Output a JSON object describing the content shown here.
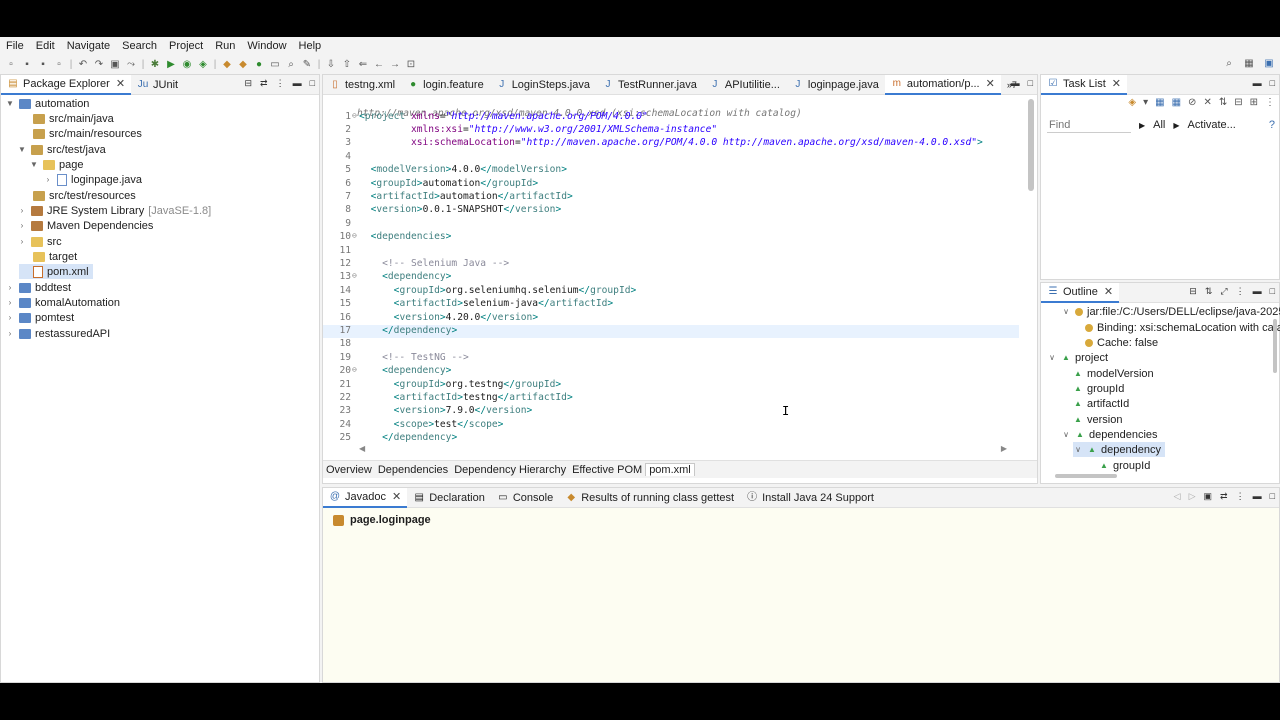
{
  "menu": [
    "File",
    "Edit",
    "Navigate",
    "Search",
    "Project",
    "Run",
    "Window",
    "Help"
  ],
  "explorer": {
    "tabs": [
      {
        "label": "Package Explorer"
      },
      {
        "label": "JUnit"
      }
    ],
    "items": [
      {
        "label": "automation"
      },
      {
        "label": "src/main/java"
      },
      {
        "label": "src/main/resources"
      },
      {
        "label": "src/test/java"
      },
      {
        "label": "page"
      },
      {
        "label": "loginpage.java"
      },
      {
        "label": "src/test/resources"
      },
      {
        "label": "JRE System Library",
        "extra": "[JavaSE-1.8]"
      },
      {
        "label": "Maven Dependencies"
      },
      {
        "label": "src"
      },
      {
        "label": "target"
      },
      {
        "label": "pom.xml"
      },
      {
        "label": "bddtest"
      },
      {
        "label": "komalAutomation"
      },
      {
        "label": "pomtest"
      },
      {
        "label": "restassuredAPI"
      }
    ]
  },
  "editor": {
    "tabs": [
      "testng.xml",
      "login.feature",
      "LoginSteps.java",
      "TestRunner.java",
      "APIutilitie...",
      "loginpage.java",
      "automation/p..."
    ],
    "overflow": "»7",
    "header_line": "http://maven.apache.org/xsd/maven-4.0.0.xsd (xsi:schemaLocation with catalog)",
    "lines": [
      {
        "n": "1",
        "fold": "⊖",
        "html": "<span class='br'>&lt;</span><span class='tagc'>project</span> <span class='attr'>xmlns</span>=<span class='str'>\"http://maven.apache.org/POM/4.0.0\"</span>"
      },
      {
        "n": "2",
        "html": "         <span class='attr'>xmlns:xsi</span>=<span class='str'>\"http://www.w3.org/2001/XMLSchema-instance\"</span>"
      },
      {
        "n": "3",
        "html": "         <span class='attr'>xsi:schemaLocation</span>=<span class='str'>\"http://maven.apache.org/POM/4.0.0 http://maven.apache.org/xsd/maven-4.0.0.xsd\"</span><span class='br'>&gt;</span>"
      },
      {
        "n": "4",
        "html": ""
      },
      {
        "n": "5",
        "html": "  <span class='br'>&lt;</span><span class='tagc'>modelVersion</span><span class='br'>&gt;</span>4.0.0<span class='br'>&lt;/</span><span class='tagc'>modelVersion</span><span class='br'>&gt;</span>"
      },
      {
        "n": "6",
        "html": "  <span class='br'>&lt;</span><span class='tagc'>groupId</span><span class='br'>&gt;</span>automation<span class='br'>&lt;/</span><span class='tagc'>groupId</span><span class='br'>&gt;</span>"
      },
      {
        "n": "7",
        "html": "  <span class='br'>&lt;</span><span class='tagc'>artifactId</span><span class='br'>&gt;</span>automation<span class='br'>&lt;/</span><span class='tagc'>artifactId</span><span class='br'>&gt;</span>"
      },
      {
        "n": "8",
        "html": "  <span class='br'>&lt;</span><span class='tagc'>version</span><span class='br'>&gt;</span>0.0.1-SNAPSHOT<span class='br'>&lt;/</span><span class='tagc'>version</span><span class='br'>&gt;</span>"
      },
      {
        "n": "9",
        "html": ""
      },
      {
        "n": "10",
        "fold": "⊖",
        "html": "  <span class='br'>&lt;</span><span class='tagc'>dependencies</span><span class='br'>&gt;</span>"
      },
      {
        "n": "11",
        "html": ""
      },
      {
        "n": "12",
        "html": "    <span class='cmt'>&lt;!-- Selenium Java --&gt;</span>"
      },
      {
        "n": "13",
        "fold": "⊖",
        "html": "    <span class='br'>&lt;</span><span class='tagc'>dependency</span><span class='br'>&gt;</span>"
      },
      {
        "n": "14",
        "html": "      <span class='br'>&lt;</span><span class='tagc'>groupId</span><span class='br'>&gt;</span>org.seleniumhq.selenium<span class='br'>&lt;/</span><span class='tagc'>groupId</span><span class='br'>&gt;</span>"
      },
      {
        "n": "15",
        "html": "      <span class='br'>&lt;</span><span class='tagc'>artifactId</span><span class='br'>&gt;</span>selenium-java<span class='br'>&lt;/</span><span class='tagc'>artifactId</span><span class='br'>&gt;</span>"
      },
      {
        "n": "16",
        "html": "      <span class='br'>&lt;</span><span class='tagc'>version</span><span class='br'>&gt;</span>4.20.0<span class='br'>&lt;/</span><span class='tagc'>version</span><span class='br'>&gt;</span>"
      },
      {
        "n": "17",
        "cur": true,
        "html": "    <span class='br'>&lt;/</span><span class='tagc'>dependency</span><span class='br'>&gt;</span>"
      },
      {
        "n": "18",
        "html": ""
      },
      {
        "n": "19",
        "html": "    <span class='cmt'>&lt;!-- TestNG --&gt;</span>"
      },
      {
        "n": "20",
        "fold": "⊖",
        "html": "    <span class='br'>&lt;</span><span class='tagc'>dependency</span><span class='br'>&gt;</span>"
      },
      {
        "n": "21",
        "html": "      <span class='br'>&lt;</span><span class='tagc'>groupId</span><span class='br'>&gt;</span>org.testng<span class='br'>&lt;/</span><span class='tagc'>groupId</span><span class='br'>&gt;</span>"
      },
      {
        "n": "22",
        "html": "      <span class='br'>&lt;</span><span class='tagc'>artifactId</span><span class='br'>&gt;</span>testng<span class='br'>&lt;/</span><span class='tagc'>artifactId</span><span class='br'>&gt;</span>"
      },
      {
        "n": "23",
        "html": "      <span class='br'>&lt;</span><span class='tagc'>version</span><span class='br'>&gt;</span>7.9.0<span class='br'>&lt;/</span><span class='tagc'>version</span><span class='br'>&gt;</span>"
      },
      {
        "n": "24",
        "html": "      <span class='br'>&lt;</span><span class='tagc'>scope</span><span class='br'>&gt;</span>test<span class='br'>&lt;/</span><span class='tagc'>scope</span><span class='br'>&gt;</span>"
      },
      {
        "n": "25",
        "html": "    <span class='br'>&lt;/</span><span class='tagc'>dependency</span><span class='br'>&gt;</span>"
      },
      {
        "n": "26",
        "html": ""
      }
    ],
    "bottom_tabs": [
      "Overview",
      "Dependencies",
      "Dependency Hierarchy",
      "Effective POM",
      "pom.xml"
    ]
  },
  "tasklist": {
    "tab": "Task List",
    "find_placeholder": "Find",
    "all": "All",
    "activate": "Activate..."
  },
  "outline": {
    "tab": "Outline",
    "items": [
      {
        "label": "jar:file:/C:/Users/DELL/eclipse/java-2025"
      },
      {
        "label": "Binding: xsi:schemaLocation with cata"
      },
      {
        "label": "Cache: false"
      },
      {
        "label": "project"
      },
      {
        "label": "modelVersion"
      },
      {
        "label": "groupId"
      },
      {
        "label": "artifactId"
      },
      {
        "label": "version"
      },
      {
        "label": "dependencies"
      },
      {
        "label": "dependency"
      },
      {
        "label": "groupId"
      }
    ]
  },
  "console": {
    "tabs": [
      "Javadoc",
      "Declaration",
      "Console",
      "Results of running class gettest",
      "Install Java 24 Support"
    ],
    "title": "page.loginpage"
  }
}
